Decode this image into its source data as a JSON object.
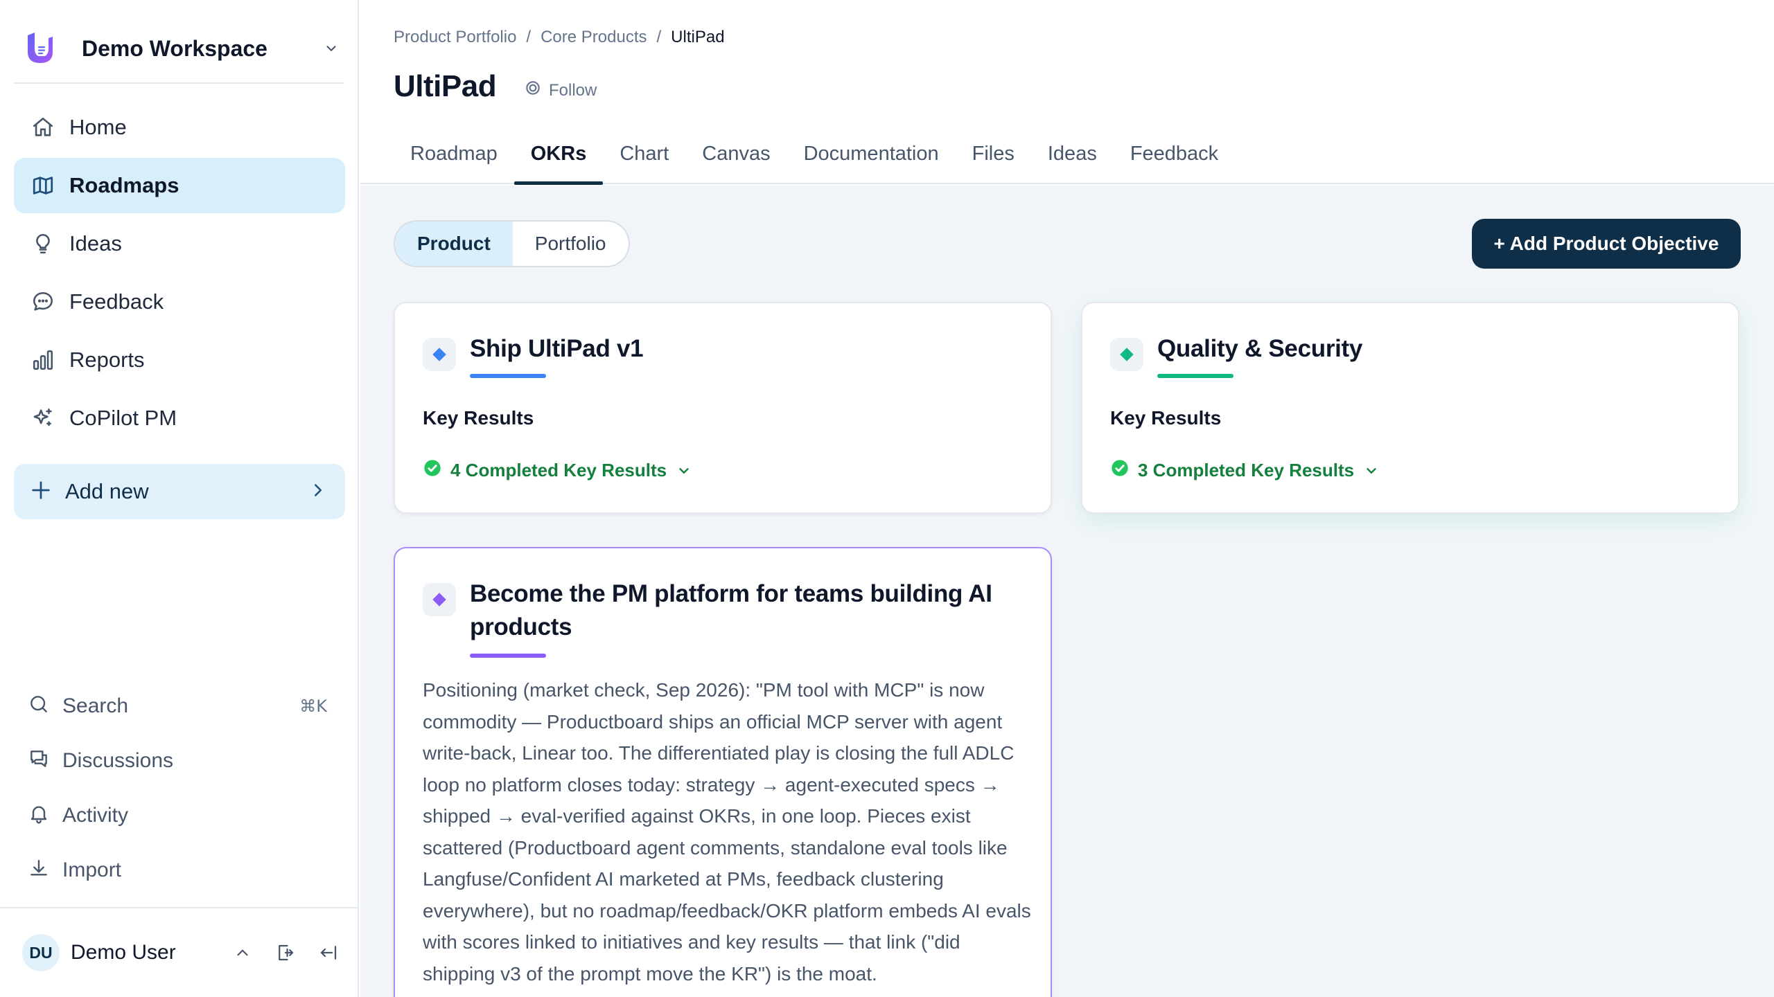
{
  "workspace": {
    "name": "Demo Workspace"
  },
  "sidebar": {
    "nav": [
      {
        "label": "Home",
        "icon": "home-icon"
      },
      {
        "label": "Roadmaps",
        "icon": "map-icon",
        "active": true
      },
      {
        "label": "Ideas",
        "icon": "lightbulb-icon"
      },
      {
        "label": "Feedback",
        "icon": "chat-bubble-icon"
      },
      {
        "label": "Reports",
        "icon": "bar-chart-icon"
      },
      {
        "label": "CoPilot PM",
        "icon": "sparkles-icon"
      }
    ],
    "add_new": {
      "label": "Add new"
    },
    "bottom": [
      {
        "label": "Search",
        "shortcut": "⌘K",
        "icon": "search-icon"
      },
      {
        "label": "Discussions",
        "icon": "discussions-icon"
      },
      {
        "label": "Activity",
        "icon": "bell-icon"
      },
      {
        "label": "Import",
        "icon": "download-icon"
      }
    ],
    "user": {
      "initials": "DU",
      "name": "Demo User"
    }
  },
  "breadcrumb": [
    "Product Portfolio",
    "Core Products",
    "UltiPad"
  ],
  "page": {
    "title": "UltiPad",
    "follow_label": "Follow"
  },
  "tabs": [
    "Roadmap",
    "OKRs",
    "Chart",
    "Canvas",
    "Documentation",
    "Files",
    "Ideas",
    "Feedback"
  ],
  "active_tab": "OKRs",
  "segment": {
    "options": [
      "Product",
      "Portfolio"
    ],
    "selected": "Product"
  },
  "add_objective_label": "+ Add Product Objective",
  "objectives": [
    {
      "title": "Ship UltiPad v1",
      "color": "#3b82f6",
      "key_results_label": "Key Results",
      "completed_label": "4 Completed Key Results"
    },
    {
      "title": "Quality & Security",
      "color": "#10b981",
      "key_results_label": "Key Results",
      "completed_label": "3 Completed Key Results"
    },
    {
      "title": "Become the PM platform for teams building AI products",
      "color": "#8b5cf6",
      "description": "Positioning (market check, Sep 2026): \"PM tool with MCP\" is now commodity — Productboard ships an official MCP server with agent write-back, Linear too. The differentiated play is closing the full ADLC loop no platform closes today: strategy → agent-executed specs → shipped → eval-verified against OKRs, in one loop. Pieces exist scattered (Productboard agent comments, standalone eval tools like Langfuse/Confident AI marketed at PMs, feedback clustering everywhere), but no roadmap/feedback/OKR platform embeds AI evals with scores linked to initiatives and key results — that link (\"did shipping v3 of the prompt move the KR\") is the moat."
    }
  ],
  "colors": {
    "accent_dark": "#0f2e47",
    "active_bg": "#d7eefb",
    "success": "#15803d"
  }
}
